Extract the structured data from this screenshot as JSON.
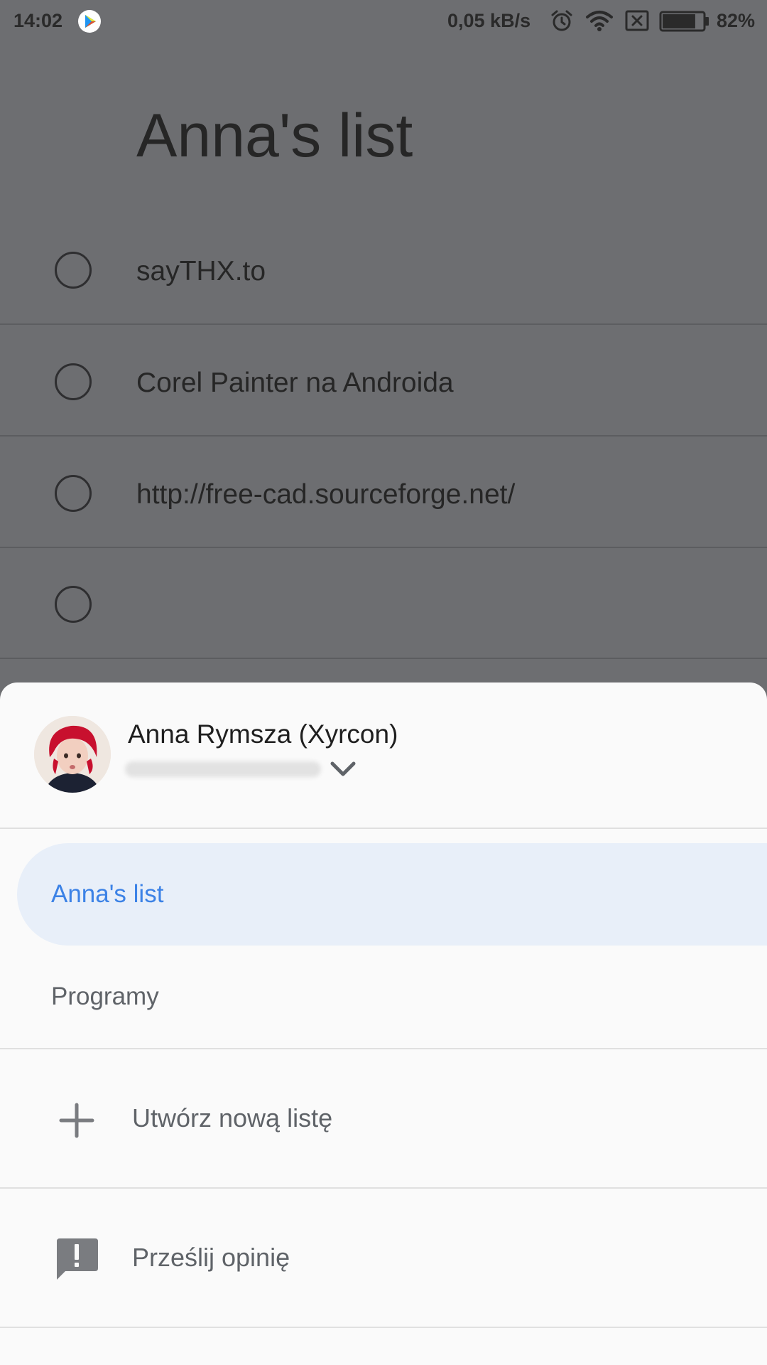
{
  "status_bar": {
    "time": "14:02",
    "network_speed": "0,05 kB/s",
    "battery_percent": "82%",
    "battery_level": 0.82,
    "icons": [
      "play-store-icon",
      "alarm-icon",
      "wifi-icon",
      "no-sim-icon",
      "battery-icon"
    ]
  },
  "background_list": {
    "title": "Anna's list",
    "tasks": [
      {
        "text": "sayTHX.to"
      },
      {
        "text": "Corel Painter na Androida"
      },
      {
        "text": "http://free-cad.sourceforge.net/"
      },
      {
        "text": ""
      }
    ]
  },
  "sheet": {
    "account": {
      "name": "Anna Rymsza (Xyrcon)"
    },
    "lists": [
      {
        "label": "Anna's list",
        "selected": true
      },
      {
        "label": "Programy",
        "selected": false
      }
    ],
    "actions": {
      "create_list": {
        "label": "Utwórz nową listę",
        "icon": "plus-icon"
      },
      "feedback": {
        "label": "Prześlij opinię",
        "icon": "feedback-icon"
      }
    }
  },
  "colors": {
    "scrim": "#6d6e71",
    "sheet_background": "#fafafa",
    "selected_item_background": "#e8eff9",
    "selected_item_text": "#3c82e6",
    "secondary_text": "#5f6368"
  }
}
